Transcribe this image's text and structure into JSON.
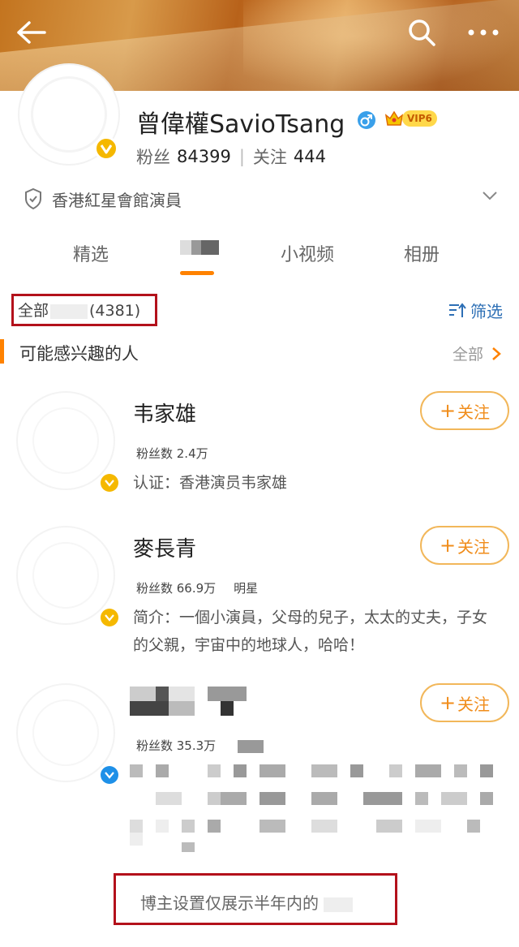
{
  "header": {
    "back_icon": "back-arrow-icon",
    "search_icon": "search-icon",
    "more_icon": "more-dots-icon"
  },
  "profile": {
    "name": "曾偉權SavioTsang",
    "gender_icon": "male-icon",
    "vip_label": "VIP6",
    "fans_label": "粉丝",
    "fans_count": "84399",
    "follow_label": "关注",
    "follow_count": "444",
    "certification": "香港紅星會館演員"
  },
  "tabs": [
    {
      "label": "精选"
    },
    {
      "label": ""
    },
    {
      "label": "小视频"
    },
    {
      "label": "相册"
    }
  ],
  "filter": {
    "all_prefix": "全部",
    "all_count": "(4381)",
    "filter_label": "筛选"
  },
  "suggestions": {
    "title": "可能感兴趣的人",
    "all_label": "全部",
    "people": [
      {
        "name": "韦家雄",
        "fans": "粉丝数 2.4万",
        "tag": "",
        "desc": "认证：香港演员韦家雄",
        "badge": "orange",
        "follow_label": "关注"
      },
      {
        "name": "麥長青",
        "fans": "粉丝数 66.9万",
        "tag": "明星",
        "desc": "简介：一個小演員，父母的兒子，太太的丈夫，子女的父親，宇宙中的地球人，哈哈！",
        "badge": "orange",
        "follow_label": "关注"
      },
      {
        "name": "",
        "fans": "粉丝数 35.3万",
        "tag": "",
        "desc": "",
        "badge": "blue",
        "follow_label": "关注"
      }
    ]
  },
  "notice": {
    "text": "博主设置仅展示半年内的"
  },
  "colors": {
    "accent": "#ff8200",
    "link": "#2d6fb5",
    "highlight_border": "#b3111b"
  }
}
